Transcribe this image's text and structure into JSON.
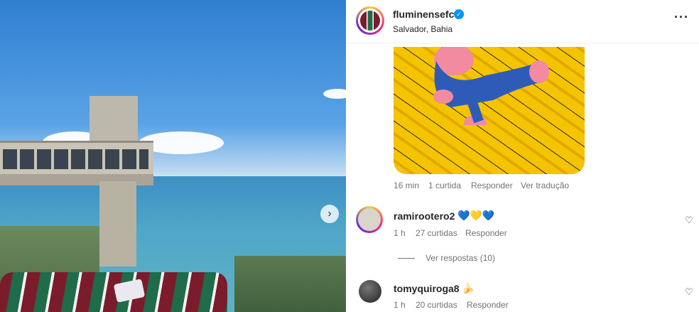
{
  "post": {
    "account": "fluminensefc",
    "location": "Salvador, Bahia",
    "verified_icon": "verified-check-icon",
    "more_icon": "more-options-icon"
  },
  "reply_meta": {
    "time": "16 min",
    "likes": "1 curtida",
    "reply": "Responder",
    "translate": "Ver tradução"
  },
  "comments": [
    {
      "user": "ramirootero2",
      "emoji": "💙💛💙",
      "time": "1 h",
      "likes": "27 curtidas",
      "reply": "Responder",
      "view_replies": "Ver respostas (10)"
    },
    {
      "user": "tomyquiroga8",
      "emoji": "🍌",
      "time": "1 h",
      "likes": "20 curtidas",
      "reply": "Responder"
    }
  ],
  "icons": {
    "next": "chevron-right-icon",
    "like": "heart-icon"
  }
}
